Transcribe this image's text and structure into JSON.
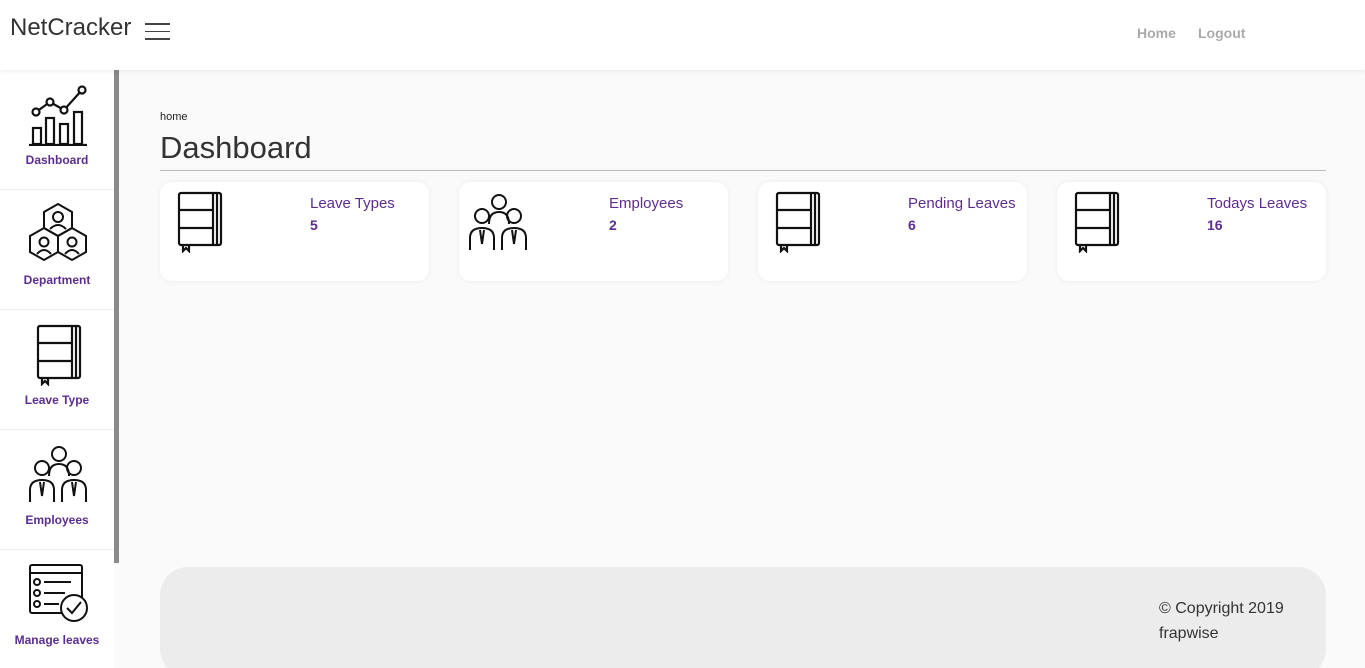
{
  "header": {
    "brand": "NetCracker",
    "nav": {
      "home": "Home",
      "logout": "Logout"
    }
  },
  "sidebar": {
    "items": [
      {
        "label": "Dashboard",
        "icon": "chart-icon"
      },
      {
        "label": "Department",
        "icon": "department-icon"
      },
      {
        "label": "Leave Type",
        "icon": "notebook-icon"
      },
      {
        "label": "Employees",
        "icon": "employees-icon"
      },
      {
        "label": "Manage leaves",
        "icon": "checklist-icon"
      }
    ]
  },
  "main": {
    "breadcrumb": "home",
    "title": "Dashboard",
    "cards": [
      {
        "title": "Leave Types",
        "count": "5",
        "icon": "notebook-icon"
      },
      {
        "title": "Employees",
        "count": "2",
        "icon": "employees-icon"
      },
      {
        "title": "Pending Leaves",
        "count": "6",
        "icon": "notebook-icon"
      },
      {
        "title": "Todays Leaves",
        "count": "16",
        "icon": "notebook-icon"
      }
    ]
  },
  "footer": {
    "copyright": "© Copyright 2019",
    "company": "frapwise"
  },
  "colors": {
    "accent": "#5b2d8e",
    "nav_text": "#aaaaaa",
    "footer_bg": "#ececec",
    "page_bg": "#fafafa"
  }
}
